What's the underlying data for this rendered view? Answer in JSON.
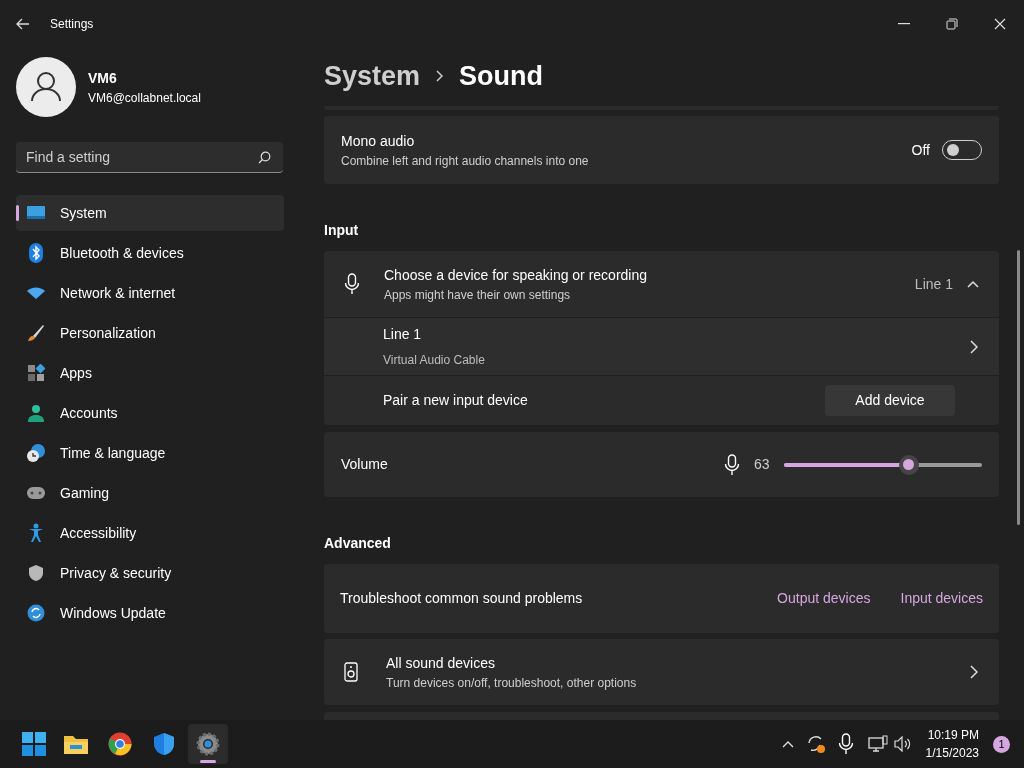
{
  "window": {
    "title": "Settings"
  },
  "user": {
    "name": "VM6",
    "email": "VM6@collabnet.local"
  },
  "search": {
    "placeholder": "Find a setting"
  },
  "sidebar": {
    "items": [
      {
        "label": "System",
        "selected": true
      },
      {
        "label": "Bluetooth & devices",
        "selected": false
      },
      {
        "label": "Network & internet",
        "selected": false
      },
      {
        "label": "Personalization",
        "selected": false
      },
      {
        "label": "Apps",
        "selected": false
      },
      {
        "label": "Accounts",
        "selected": false
      },
      {
        "label": "Time & language",
        "selected": false
      },
      {
        "label": "Gaming",
        "selected": false
      },
      {
        "label": "Accessibility",
        "selected": false
      },
      {
        "label": "Privacy & security",
        "selected": false
      },
      {
        "label": "Windows Update",
        "selected": false
      }
    ]
  },
  "breadcrumb": [
    "System",
    "Sound"
  ],
  "mono_audio": {
    "title": "Mono audio",
    "subtitle": "Combine left and right audio channels into one",
    "state_label": "Off",
    "on": false
  },
  "input": {
    "heading": "Input",
    "device_picker": {
      "title": "Choose a device for speaking or recording",
      "subtitle": "Apps might have their own settings",
      "value": "Line 1",
      "expanded": true
    },
    "device": {
      "name": "Line 1",
      "description": "Virtual Audio Cable"
    },
    "pair": {
      "label": "Pair a new input device",
      "button": "Add device"
    },
    "volume": {
      "label": "Volume",
      "reading": "63",
      "level": 0.63
    }
  },
  "advanced": {
    "heading": "Advanced",
    "troubleshoot": {
      "label": "Troubleshoot common sound problems",
      "links": [
        "Output devices",
        "Input devices"
      ]
    },
    "all_devices": {
      "title": "All sound devices",
      "subtitle": "Turn devices on/off, troubleshoot, other options"
    }
  },
  "taskbar": {
    "time": "10:19 PM",
    "date": "1/15/2023",
    "notification_count": "1"
  }
}
